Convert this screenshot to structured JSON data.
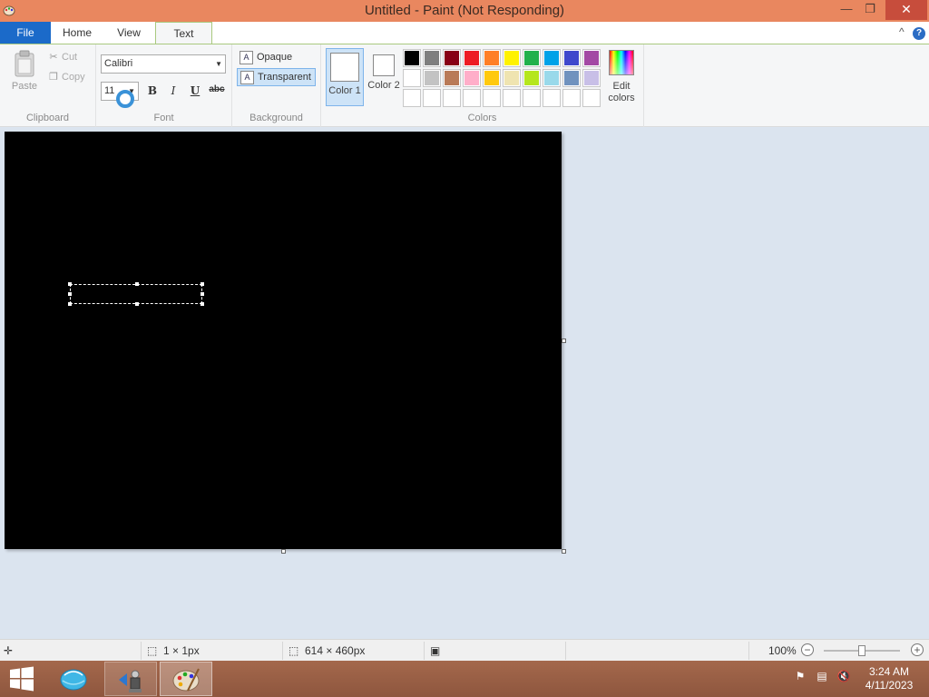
{
  "window": {
    "title": "Untitled - Paint (Not Responding)",
    "minimize_glyph": "—",
    "maximize_glyph": "❐",
    "close_glyph": "✕"
  },
  "tabs": {
    "file": "File",
    "home": "Home",
    "view": "View",
    "text": "Text",
    "collapse_glyph": "^",
    "help_glyph": "?"
  },
  "clipboard": {
    "paste": "Paste",
    "cut": "Cut",
    "copy": "Copy",
    "group_label": "Clipboard"
  },
  "font": {
    "family": "Calibri",
    "size": "11",
    "bold": "B",
    "italic": "I",
    "underline": "U",
    "strikethrough": "abc",
    "group_label": "Font"
  },
  "background": {
    "opaque": "Opaque",
    "transparent": "Transparent",
    "icon_letter": "A",
    "group_label": "Background",
    "selected": "Transparent"
  },
  "colors": {
    "color1_label": "Color 1",
    "color2_label": "Color 2",
    "color1_value": "#ffffff",
    "color2_value": "#ffffff",
    "edit_colors": "Edit colors",
    "group_label": "Colors",
    "palette": [
      [
        "#000000",
        "#7f7f7f",
        "#880015",
        "#ed1c24",
        "#ff7f27",
        "#fff200",
        "#22b14c",
        "#00a2e8",
        "#3f48cc",
        "#a349a4"
      ],
      [
        "#ffffff",
        "#c3c3c3",
        "#b97a57",
        "#ffaec9",
        "#ffc90e",
        "#efe4b0",
        "#b5e61d",
        "#99d9ea",
        "#7092be",
        "#c8bfe7"
      ],
      [
        "",
        "",
        "",
        "",
        "",
        "",
        "",
        "",
        "",
        ""
      ]
    ]
  },
  "canvas": {
    "background_color": "#000000"
  },
  "status": {
    "selection_size": "1 × 1px",
    "image_size": "614 × 460px",
    "zoom": "100%"
  },
  "taskbar": {
    "time": "3:24 AM",
    "date": "4/11/2023"
  }
}
